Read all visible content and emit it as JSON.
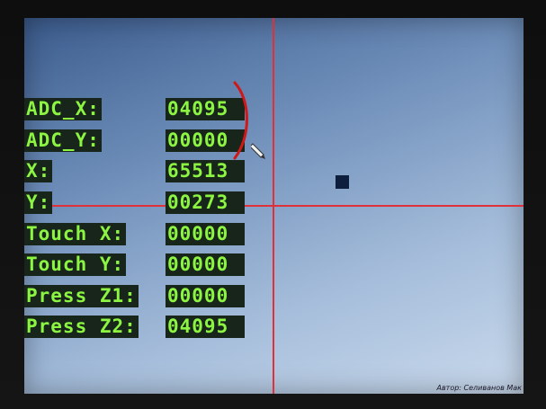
{
  "readouts": [
    {
      "label": "ADC_X:",
      "value": "04095"
    },
    {
      "label": "ADC_Y:",
      "value": "00000"
    },
    {
      "label": "X:",
      "value": "65513"
    },
    {
      "label": "Y:",
      "value": "00273"
    },
    {
      "label": "Touch X:",
      "value": "00000"
    },
    {
      "label": "Touch Y:",
      "value": "00000"
    },
    {
      "label": "Press Z1:",
      "value": "00000"
    },
    {
      "label": "Press Z2:",
      "value": "04095"
    }
  ],
  "credit": "Автор: Селиванов Мак",
  "colors": {
    "text": "#8cf542",
    "text_bg": "#17251b",
    "crosshair": "#e0303a",
    "marker": "#0d1f3c",
    "annotation": "#d01818"
  }
}
